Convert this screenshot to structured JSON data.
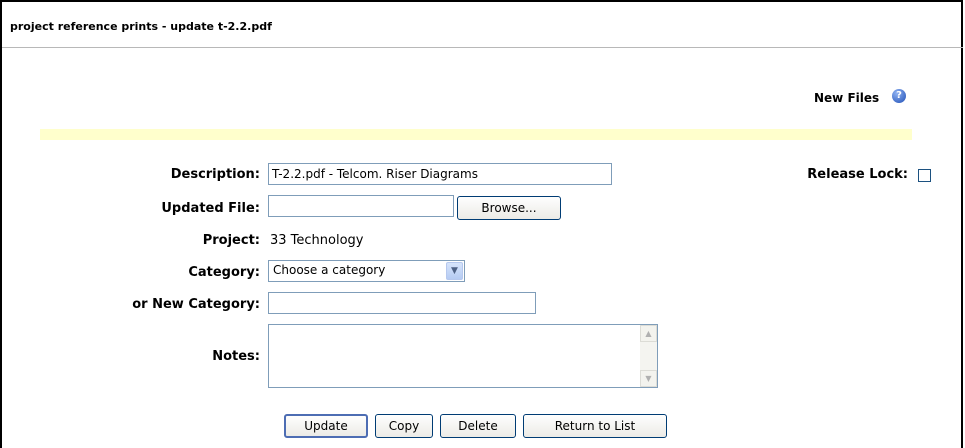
{
  "page": {
    "title": "project reference prints - update t-2.2.pdf"
  },
  "header": {
    "new_files_label": "New Files",
    "help_icon": "question-circle-icon"
  },
  "form": {
    "description": {
      "label": "Description:",
      "value": "T-2.2.pdf - Telcom. Riser Diagrams"
    },
    "release_lock": {
      "label": "Release Lock:",
      "checked": false
    },
    "updated_file": {
      "label": "Updated File:",
      "value": "",
      "browse_label": "Browse..."
    },
    "project": {
      "label": "Project:",
      "value": "33 Technology"
    },
    "category": {
      "label": "Category:",
      "selected": "Choose a category"
    },
    "new_category": {
      "label": "or New Category:",
      "value": ""
    },
    "notes": {
      "label": "Notes:",
      "value": ""
    }
  },
  "buttons": {
    "update": "Update",
    "copy": "Copy",
    "delete": "Delete",
    "return": "Return to List"
  },
  "colors": {
    "highlight_bar": "#ffffcc",
    "border": "#7f9db9",
    "help_icon": "#1f4fb6"
  }
}
